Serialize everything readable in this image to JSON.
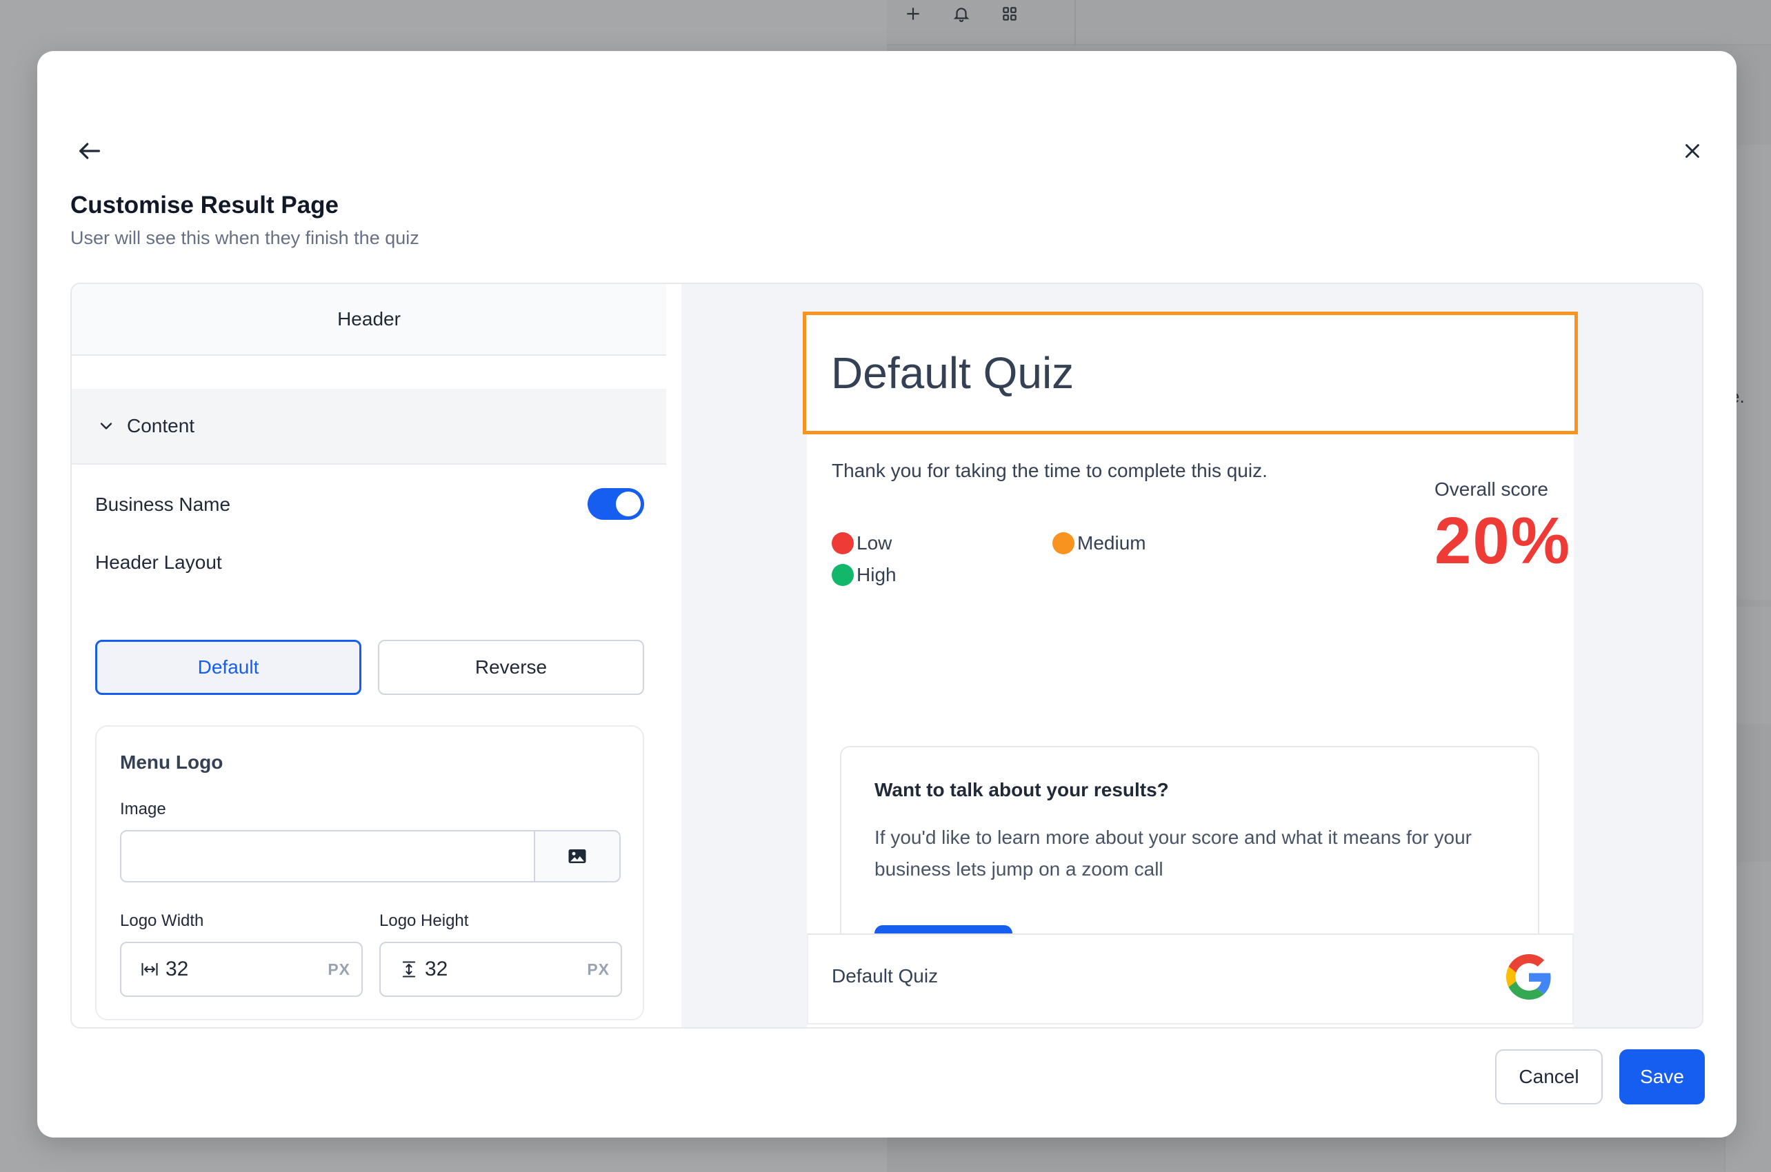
{
  "modal": {
    "title": "Customise Result Page",
    "subtitle": "User will see this when they finish the quiz"
  },
  "editor": {
    "tab_label": "Header",
    "section_label": "Content",
    "business_name_label": "Business Name",
    "business_name_enabled": true,
    "header_layout_label": "Header Layout",
    "layout_options": [
      "Default",
      "Reverse"
    ],
    "selected_layout": "Default",
    "menu_logo": {
      "title": "Menu Logo",
      "image_label": "Image",
      "image_value": "",
      "logo_width_label": "Logo Width",
      "logo_width_value": "32",
      "logo_height_label": "Logo Height",
      "logo_height_value": "32",
      "unit": "PX"
    }
  },
  "preview": {
    "quiz_title": "Default Quiz",
    "thanks_text": "Thank you for taking the time to complete this quiz.",
    "legend": [
      {
        "label": "Low",
        "color": "#ef3b36"
      },
      {
        "label": "Medium",
        "color": "#f7931e"
      },
      {
        "label": "High",
        "color": "#12b76a"
      }
    ],
    "score_label": "Overall score",
    "score_value": "20%",
    "score_color": "#ef3b36",
    "cta_title": "Want to talk about your results?",
    "cta_body": "If you'd like to learn more about your score and what it means for your business lets jump on a zoom call",
    "footer_text": "Default Quiz"
  },
  "actions": {
    "cancel_label": "Cancel",
    "save_label": "Save"
  },
  "colors": {
    "accent": "#155eef",
    "highlight": "#f7931e"
  },
  "background": {
    "topbar_icons": [
      "plus-icon",
      "bell-icon",
      "grid-icon"
    ],
    "side_text": "e."
  }
}
